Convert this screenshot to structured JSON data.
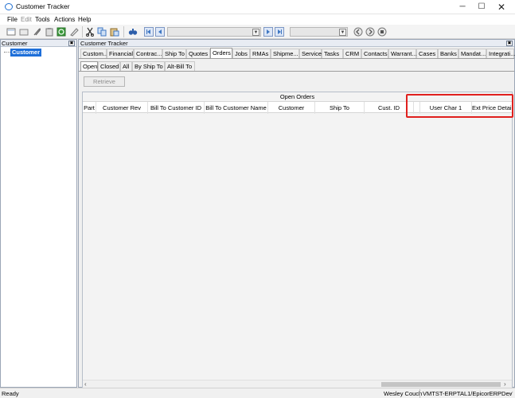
{
  "window": {
    "title": "Customer Tracker",
    "minimize": "─",
    "maximize": "☐",
    "close": "✕"
  },
  "menu": [
    "File",
    "Edit",
    "Tools",
    "Actions",
    "Help"
  ],
  "left_pane": {
    "title": "Customer",
    "tree_item": "Customer"
  },
  "right_pane": {
    "title": "Customer Tracker",
    "tabs": [
      "Custom...",
      "Financial",
      "Contrac...",
      "Ship To",
      "Quotes",
      "Orders",
      "Jobs",
      "RMAs",
      "Shipme...",
      "Service",
      "Tasks",
      "CRM",
      "Contacts",
      "Warrant...",
      "Cases",
      "Banks",
      "Mandat...",
      "Integrati..."
    ],
    "active_tab": "Orders",
    "subtabs": [
      "Open",
      "Closed",
      "All",
      "By Ship To",
      "Alt-Bill To"
    ],
    "active_subtab": "Open",
    "retrieve_label": "Retrieve",
    "grid": {
      "band_title": "Open Orders",
      "columns": [
        "Part",
        "Customer Rev",
        "Bill To Customer ID",
        "Bill To Customer Name",
        "Customer",
        "Ship To",
        "Cust. ID",
        "",
        "User Char 1",
        "Ext Price Detail"
      ]
    }
  },
  "status": {
    "ready": "Ready",
    "user": "Wesley Couch",
    "server": "VMTST-ERPTAL1/EpicorERPDev"
  },
  "colors": {
    "accent": "#1e6fd9",
    "highlight": "#e0201e"
  }
}
